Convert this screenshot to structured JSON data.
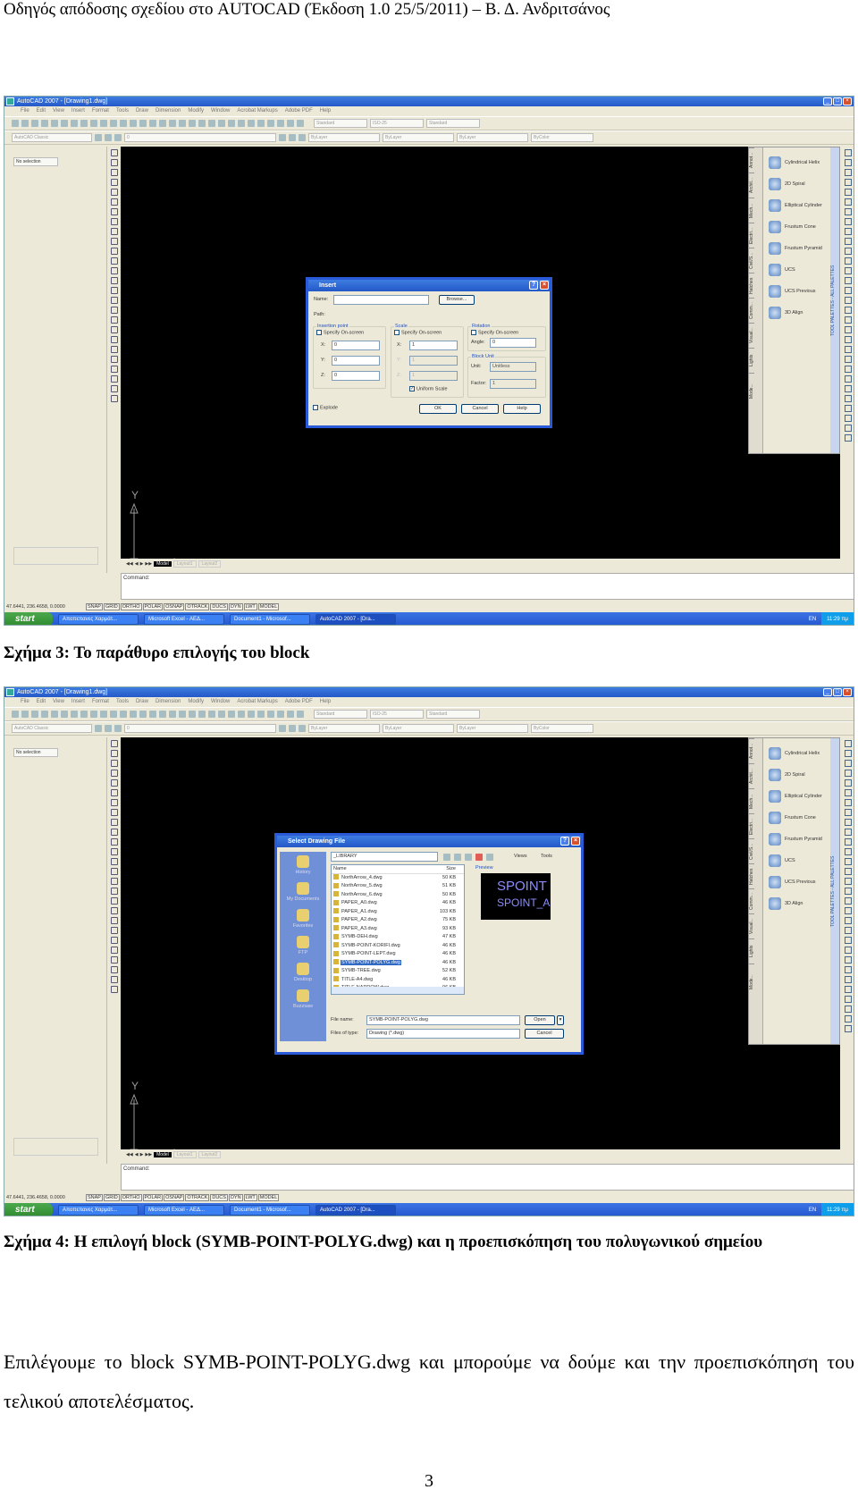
{
  "header": "Οδηγός απόδοσης σχεδίου στο AUTOCAD (Έκδοση 1.0 25/5/2011) – Β. Δ. Ανδριτσάνος",
  "app": {
    "title": "AutoCAD 2007 - [Drawing1.dwg]",
    "menu": [
      "File",
      "Edit",
      "View",
      "Insert",
      "Format",
      "Tools",
      "Draw",
      "Dimension",
      "Modify",
      "Window",
      "Acrobat Markups",
      "Adobe PDF",
      "Help"
    ],
    "workspace": "AutoCAD Classic",
    "text_style": "Standard",
    "dim_style": "ISO-25",
    "table_style": "Standard",
    "layer": "0",
    "color": "ByLayer",
    "linetype": "ByLayer",
    "lineweight": "ByLayer",
    "plot_style": "ByColor",
    "properties_selection": "No selection",
    "layout_tabs": [
      "Model",
      "Layout1",
      "Layout2"
    ],
    "command_prompt": "Command:",
    "coordinates": "47.6441, 236.4658, 0.0000",
    "status_buttons": [
      "SNAP",
      "GRID",
      "ORTHO",
      "POLAR",
      "OSNAP",
      "OTRACK",
      "DUCS",
      "DYN",
      "LWT",
      "MODEL"
    ],
    "palette_tabs": [
      "Annot...",
      "Archit...",
      "Mech...",
      "Electri...",
      "Civil/S...",
      "Hatches",
      "Comm...",
      "Visual...",
      "Lights",
      "Mode..."
    ],
    "palette_items": [
      "Cylindrical Helix",
      "2D Spiral",
      "Elliptical Cylinder",
      "Frustum Cone",
      "Frustum Pyramid",
      "UCS",
      "UCS Previous",
      "3D Align"
    ],
    "palette_title": "TOOL PALETTES - ALL PALETTES",
    "ucs": {
      "x": "X",
      "y": "Y"
    },
    "taskbar": {
      "start": "start",
      "items": [
        "Αποπεπανες Χαρμάτ...",
        "Microsoft Excel - ΑΕΔ...",
        "Document1 - Microsof...",
        "AutoCAD 2007 - [Dra..."
      ],
      "lang": "EN",
      "clock": "11:29 πμ"
    }
  },
  "insert_dialog": {
    "title": "Insert",
    "name_label": "Name:",
    "name_value": "",
    "browse": "Browse...",
    "path_label": "Path:",
    "insertion": {
      "label": "Insertion point",
      "specify": "Specify On-screen",
      "x": "0",
      "y": "0",
      "z": "0"
    },
    "scale": {
      "label": "Scale",
      "specify": "Specify On-screen",
      "x": "1",
      "y": "1",
      "z": "1",
      "uniform": "Uniform Scale",
      "uniform_checked": true
    },
    "rotation": {
      "label": "Rotation",
      "specify": "Specify On-screen",
      "angle_label": "Angle:",
      "angle": "0"
    },
    "block_unit": {
      "label": "Block Unit",
      "unit_label": "Unit:",
      "unit": "Unitless",
      "factor_label": "Factor:",
      "factor": "1"
    },
    "explode": "Explode",
    "ok": "OK",
    "cancel": "Cancel",
    "help": "Help"
  },
  "file_dialog": {
    "title": "Select Drawing File",
    "look_in_label": "Look in:",
    "look_in": "_LIBRARY",
    "views": "Views",
    "tools": "Tools",
    "preview_label": "Preview",
    "preview_text": [
      "SPOINT",
      "SPOINT_A"
    ],
    "places": [
      "History",
      "My Documents",
      "Favorites",
      "FTP",
      "Desktop",
      "Buzzsaw"
    ],
    "columns": [
      "Name",
      "Size"
    ],
    "files": [
      {
        "name": "NorthArrow_4.dwg",
        "size": "50 KB"
      },
      {
        "name": "NorthArrow_5.dwg",
        "size": "51 KB"
      },
      {
        "name": "NorthArrow_6.dwg",
        "size": "50 KB"
      },
      {
        "name": "PAPER_A0.dwg",
        "size": "46 KB"
      },
      {
        "name": "PAPER_A1.dwg",
        "size": "103 KB"
      },
      {
        "name": "PAPER_A2.dwg",
        "size": "75 KB"
      },
      {
        "name": "PAPER_A3.dwg",
        "size": "93 KB"
      },
      {
        "name": "SYMB-DEH.dwg",
        "size": "47 KB"
      },
      {
        "name": "SYMB-POINT-KORIFI.dwg",
        "size": "46 KB"
      },
      {
        "name": "SYMB-POINT-LEPT.dwg",
        "size": "46 KB"
      },
      {
        "name": "SYMB-POINT-POLYG.dwg",
        "size": "46 KB",
        "selected": true
      },
      {
        "name": "SYMB-TREE.dwg",
        "size": "52 KB"
      },
      {
        "name": "TITLE-A4.dwg",
        "size": "46 KB"
      },
      {
        "name": "TITLE-NARROW.dwg",
        "size": "96 KB"
      }
    ],
    "file_name_label": "File name:",
    "file_name": "SYMB-POINT-POLYG.dwg",
    "file_type_label": "Files of type:",
    "file_type": "Drawing (*.dwg)",
    "open": "Open",
    "cancel": "Cancel"
  },
  "caption3": "Σχήμα 3: Το παράθυρο επιλογής του block",
  "caption4": "Σχήμα 4: Η επιλογή block (SYMB-POINT-POLYG.dwg) και η προεπισκόπηση του πολυγωνικού σημείου",
  "paragraph": "Επιλέγουμε το block SYMB-POINT-POLYG.dwg και μπορούμε να δούμε και την προεπισκόπηση του τελικού αποτελέσματος.",
  "page_number": "3"
}
